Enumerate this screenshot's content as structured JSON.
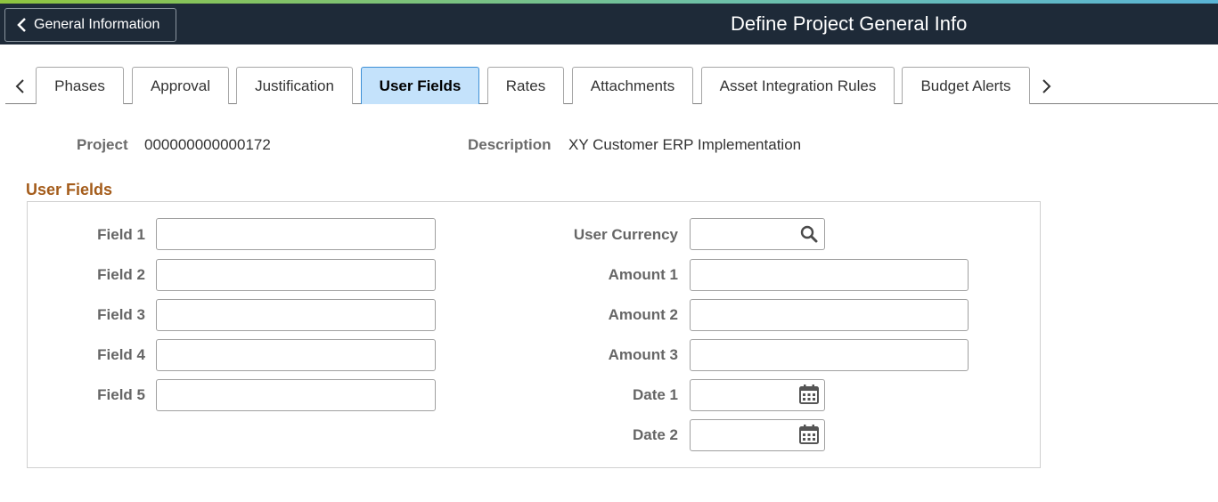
{
  "header": {
    "back_label": "General Information",
    "title": "Define Project General Info"
  },
  "tabs": [
    {
      "label": "Phases",
      "active": false
    },
    {
      "label": "Approval",
      "active": false
    },
    {
      "label": "Justification",
      "active": false
    },
    {
      "label": "User Fields",
      "active": true
    },
    {
      "label": "Rates",
      "active": false
    },
    {
      "label": "Attachments",
      "active": false
    },
    {
      "label": "Asset Integration Rules",
      "active": false
    },
    {
      "label": "Budget Alerts",
      "active": false
    }
  ],
  "project": {
    "project_label": "Project",
    "project_value": "000000000000172",
    "description_label": "Description",
    "description_value": "XY Customer ERP Implementation"
  },
  "section": {
    "title": "User Fields"
  },
  "left_fields": [
    {
      "label": "Field 1",
      "value": ""
    },
    {
      "label": "Field 2",
      "value": ""
    },
    {
      "label": "Field 3",
      "value": ""
    },
    {
      "label": "Field 4",
      "value": ""
    },
    {
      "label": "Field 5",
      "value": ""
    }
  ],
  "right_fields": [
    {
      "label": "User Currency",
      "value": "",
      "icon": "search-icon"
    },
    {
      "label": "Amount 1",
      "value": ""
    },
    {
      "label": "Amount 2",
      "value": ""
    },
    {
      "label": "Amount 3",
      "value": ""
    },
    {
      "label": "Date 1",
      "value": "",
      "icon": "calendar-icon"
    },
    {
      "label": "Date 2",
      "value": "",
      "icon": "calendar-icon"
    }
  ],
  "colors": {
    "header_bg": "#1e2a38",
    "active_tab_bg": "#c4e2fb",
    "section_title": "#a45c1b"
  }
}
